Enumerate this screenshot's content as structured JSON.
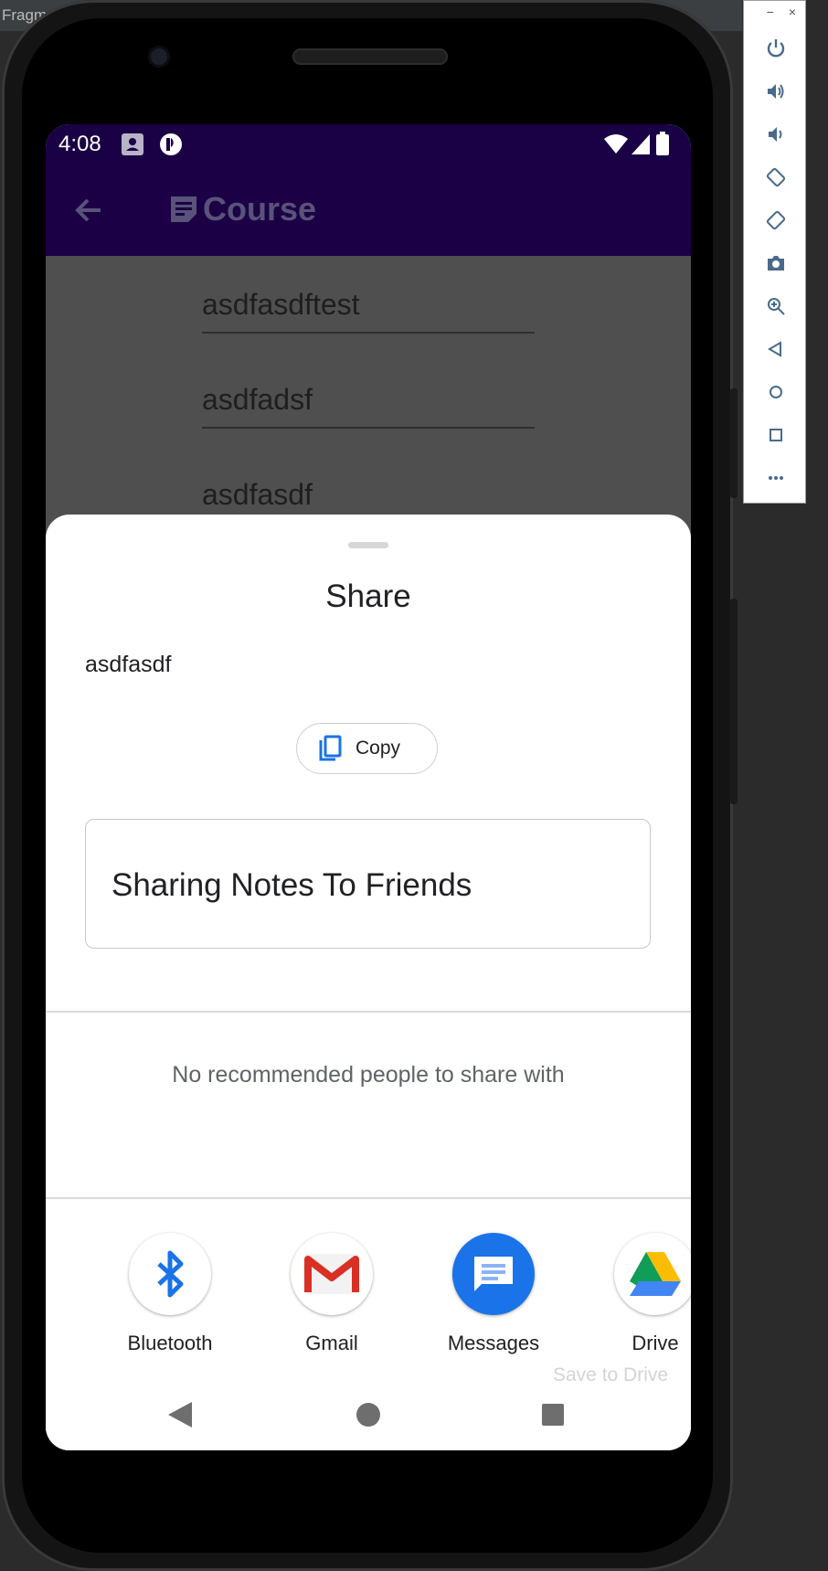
{
  "window": {
    "title": "Fragm"
  },
  "emulator_toolbar": {
    "minimize_label": "−",
    "close_label": "×",
    "buttons": [
      "power-icon",
      "volume-up-icon",
      "volume-down-icon",
      "rotate-left-icon",
      "rotate-right-icon",
      "camera-icon",
      "zoom-icon",
      "back-icon",
      "home-icon",
      "overview-icon",
      "more-icon"
    ]
  },
  "status_bar": {
    "time": "4:08"
  },
  "app_bar": {
    "title": "Course",
    "back_icon": "arrow-back-icon",
    "title_icon": "note-icon"
  },
  "form_fields": [
    {
      "value": "asdfasdftest"
    },
    {
      "value": "asdfadsf"
    },
    {
      "value": "asdfasdf"
    }
  ],
  "share_sheet": {
    "title": "Share",
    "shared_text": "asdfasdf",
    "copy_label": "Copy",
    "preview_title": "Sharing Notes To Friends",
    "no_recommendations": "No recommended people to share with",
    "targets": [
      {
        "label": "Bluetooth",
        "icon": "bluetooth-icon"
      },
      {
        "label": "Gmail",
        "icon": "gmail-icon"
      },
      {
        "label": "Messages",
        "icon": "messages-icon"
      },
      {
        "label": "Drive",
        "sublabel": "Save to Drive",
        "icon": "drive-icon"
      }
    ]
  },
  "colors": {
    "status_bar": "#1a0044",
    "app_bar": "#1c0045",
    "scrim": "#4f4f4f",
    "accent_blue": "#1a73e8"
  }
}
